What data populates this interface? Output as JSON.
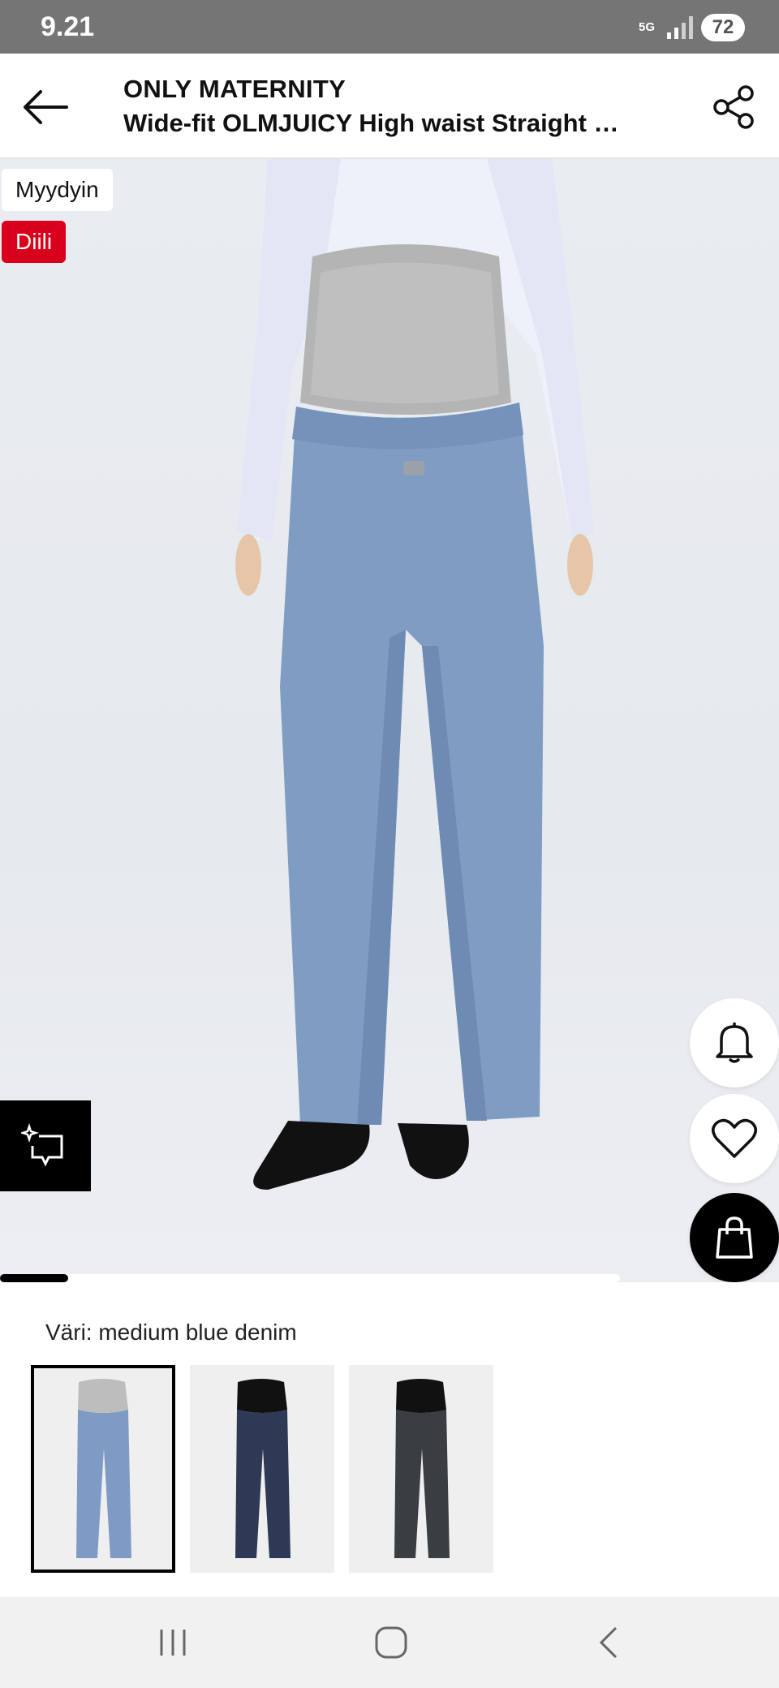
{
  "status_bar": {
    "time": "9.21",
    "network": "5G",
    "battery": "72"
  },
  "header": {
    "brand": "ONLY MATERNITY",
    "title": "Wide-fit OLMJUICY High waist Straight …",
    "back_icon": "arrow-left-icon",
    "share_icon": "share-icon"
  },
  "product_image": {
    "badges": {
      "sold": "Myydyin",
      "deal": "Diili"
    },
    "deal_color": "#d9001b",
    "carousel_progress": 0.11,
    "actions": [
      "bell-icon",
      "heart-icon",
      "shopping-bag-icon",
      "try-on-icon"
    ]
  },
  "colors": {
    "label": "Väri: medium blue denim",
    "swatches": [
      {
        "name": "medium blue denim",
        "jeans": "#7d9bc4",
        "band": "#bdbdbd",
        "selected": true
      },
      {
        "name": "dark blue denim",
        "jeans": "#2e3a55",
        "band": "#111111",
        "selected": false
      },
      {
        "name": "black denim",
        "jeans": "#3a3d42",
        "band": "#111111",
        "selected": false
      }
    ]
  },
  "nav_bar": {
    "items": [
      "recent-apps-icon",
      "home-icon",
      "back-icon"
    ]
  }
}
